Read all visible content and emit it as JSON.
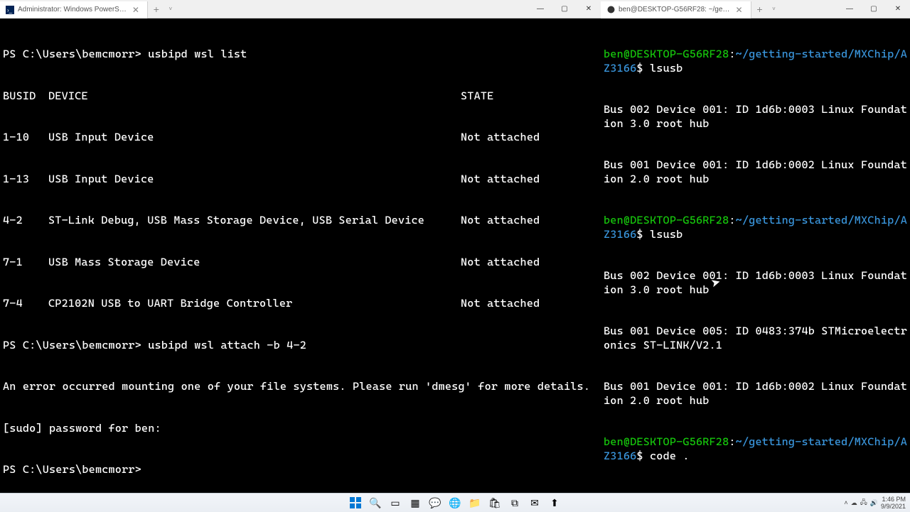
{
  "left_window": {
    "tab_title": "Administrator: Windows PowerS…",
    "prompt_path": "PS C:\\Users\\bemcmorr>",
    "cmd1": "usbipd wsl list",
    "table_header": {
      "busid": "BUSID",
      "device": "DEVICE",
      "state": "STATE"
    },
    "rows": [
      {
        "busid": "1-10",
        "device": "USB Input Device",
        "state": "Not attached"
      },
      {
        "busid": "1-13",
        "device": "USB Input Device",
        "state": "Not attached"
      },
      {
        "busid": "4-2",
        "device": "ST-Link Debug, USB Mass Storage Device, USB Serial Device",
        "state": "Not attached"
      },
      {
        "busid": "7-1",
        "device": "USB Mass Storage Device",
        "state": "Not attached"
      },
      {
        "busid": "7-4",
        "device": "CP2102N USB to UART Bridge Controller",
        "state": "Not attached"
      }
    ],
    "cmd2": "usbipd wsl attach -b 4-2",
    "error_line": "An error occurred mounting one of your file systems. Please run 'dmesg' for more details.",
    "sudo_line": "[sudo] password for ben:",
    "prompt_final": "PS C:\\Users\\bemcmorr>"
  },
  "right_window": {
    "tab_title": "ben@DESKTOP-G56RF28: ~/ge…",
    "prompt_user": "ben@DESKTOP-G56RF28",
    "prompt_path": "~/getting-started/MXChip/AZ3166",
    "dollar": "$",
    "cmd_lsusb": "lsusb",
    "out1_a": "Bus 002 Device 001: ID 1d6b:0003 Linux Foundation 3.0 root hub",
    "out1_b": "Bus 001 Device 001: ID 1d6b:0002 Linux Foundation 2.0 root hub",
    "out2_a": "Bus 002 Device 001: ID 1d6b:0003 Linux Foundation 3.0 root hub",
    "out2_b": "Bus 001 Device 005: ID 0483:374b STMicroelectronics ST-LINK/V2.1",
    "out2_c": "Bus 001 Device 001: ID 1d6b:0002 Linux Foundation 2.0 root hub",
    "cmd_code": "code ."
  },
  "taskbar": {
    "time": "1:46 PM",
    "date": "9/9/2021"
  },
  "chars": {
    "plus": "+",
    "chevron_down": "˅",
    "close_x": "✕",
    "minimize": "—",
    "maximize": "▢"
  }
}
